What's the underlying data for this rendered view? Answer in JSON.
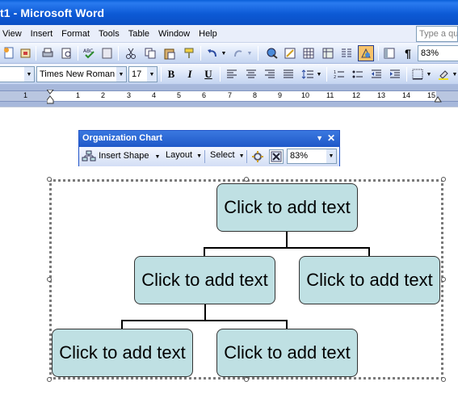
{
  "window": {
    "title": "t1 - Microsoft Word"
  },
  "menu": {
    "items": [
      "View",
      "Insert",
      "Format",
      "Tools",
      "Table",
      "Window",
      "Help"
    ],
    "ask_placeholder": "Type a que"
  },
  "toolbar_standard": {
    "zoom": "83%",
    "pilcrow": "¶"
  },
  "toolbar_formatting": {
    "font": "Times New Roman",
    "size": "17",
    "bold": "B",
    "italic": "I",
    "underline": "U"
  },
  "ruler": {
    "numbers": [
      "1",
      "1",
      "2",
      "3",
      "4",
      "5",
      "6",
      "7",
      "8",
      "9",
      "10",
      "11",
      "12",
      "13",
      "14",
      "15"
    ]
  },
  "org_toolbar": {
    "title": "Organization Chart",
    "insert_shape": "Insert Shape",
    "layout": "Layout",
    "select": "Select",
    "zoom": "83%"
  },
  "org_chart": {
    "nodes": [
      "Click to add text",
      "Click to add text",
      "Click to add text",
      "Click to add text",
      "Click to add text"
    ]
  },
  "colors": {
    "node_fill": "#bfe0e3",
    "titlebar": "#0a5fd8"
  }
}
